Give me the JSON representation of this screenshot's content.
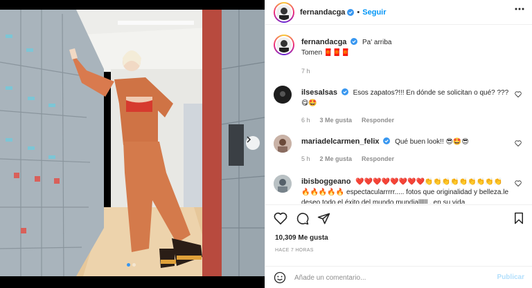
{
  "post": {
    "username": "fernandacga",
    "follow_label": "Seguir",
    "separator": "•"
  },
  "caption": {
    "username": "fernandacga",
    "text_line1": "Pa' arriba",
    "text_line2": "Tomen 🧧🧧🧧",
    "time": "7 h"
  },
  "comments": [
    {
      "username": "ilsesalsas",
      "verified": true,
      "text": "Esos zapatos?!!! En dónde se solicitan o qué? ???😋🤩",
      "time": "6 h",
      "likes": "3 Me gusta",
      "reply": "Responder"
    },
    {
      "username": "mariadelcarmen_felix",
      "verified": true,
      "text": "Qué buen look!! 😎🤩😎",
      "time": "5 h",
      "likes": "2 Me gusta",
      "reply": "Responder"
    },
    {
      "username": "ibisboggeano",
      "verified": false,
      "text": "❤️❤️❤️❤️❤️❤️❤️❤️👏👏👏👏👏👏👏👏👏🔥🔥🔥🔥🔥 espectacularrrrr..... fotos que originalidad y belleza.le deseo todo el éxito del mundo mundiallllll...en su vida"
    }
  ],
  "footer": {
    "likes": "10,309 Me gusta",
    "time": "HACE 7 HORAS",
    "comment_placeholder": "Añade un comentario...",
    "publish_label": "Publicar"
  },
  "icons": {
    "verified": "verified-badge-icon",
    "more": "more-horizontal-icon",
    "heart": "heart-outline-icon",
    "comment": "comment-bubble-icon",
    "share": "paper-plane-icon",
    "save": "bookmark-icon",
    "emoji": "smiley-icon",
    "next": "chevron-right-icon"
  },
  "colors": {
    "accent": "#0095f6",
    "verified": "#3897f0",
    "publish_disabled": "#b2dffc",
    "muted": "#8e8e8e"
  },
  "carousel": {
    "slide_count": 2,
    "active_slide": 1
  }
}
